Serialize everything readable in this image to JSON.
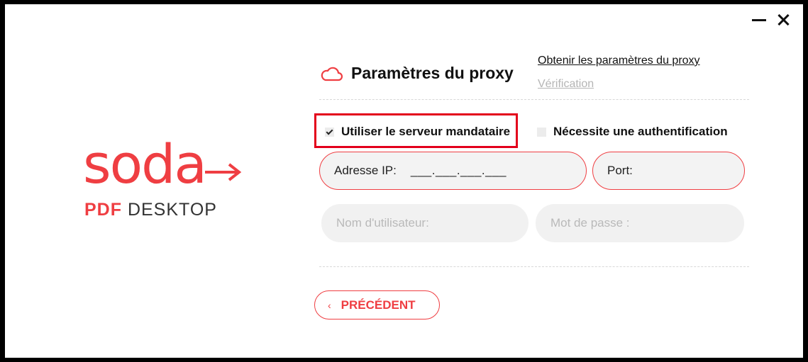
{
  "window": {
    "minimize_icon": "minimize-icon",
    "close_icon": "close-icon"
  },
  "logo": {
    "word": "soda",
    "sub_pdf": "PDF",
    "sub_desktop": "DESKTOP",
    "brand_color": "#ef3e42"
  },
  "header": {
    "title": "Paramètres du proxy",
    "icon": "cloud-icon",
    "link_get": "Obtenir les paramètres du proxy",
    "link_verification": "Vérification"
  },
  "options": {
    "use_proxy": {
      "label": "Utiliser le serveur mandataire",
      "checked": true
    },
    "needs_auth": {
      "label": "Nécessite une authentification",
      "checked": false
    }
  },
  "fields": {
    "ip_label": "Adresse IP:",
    "ip_value": "___.___.___.___",
    "port_label": "Port:",
    "username_placeholder": "Nom d'utilisateur:",
    "password_placeholder": "Mot de passe :"
  },
  "buttons": {
    "previous": "PRÉCÉDENT",
    "previous_icon": "chevron-left-icon"
  }
}
